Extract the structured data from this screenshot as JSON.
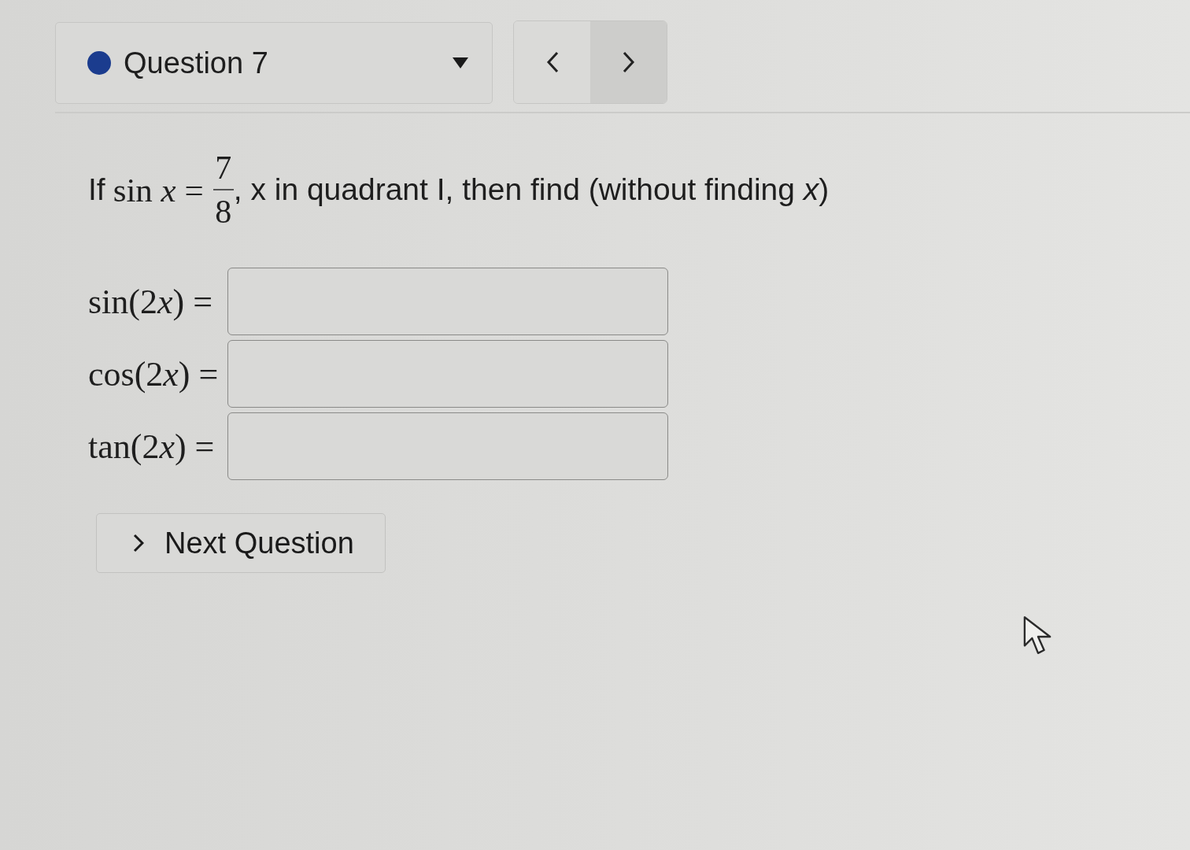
{
  "header": {
    "question_select": {
      "label": "Question 7"
    },
    "nav_buttons": [
      {
        "kind": "previous",
        "highlighted": false
      },
      {
        "kind": "next",
        "highlighted": true
      }
    ]
  },
  "question": {
    "prefix": "If",
    "math": "sin *x* =",
    "numerator": "7",
    "denominator": "8",
    "suffix": ", x in quadrant I, then find (without finding *x*)"
  },
  "answers": [
    {
      "before": "sin(2",
      "var": "x",
      "after": ") ="
    },
    {
      "before": "cos(2",
      "var": "x",
      "after": ") ="
    },
    {
      "before": "tan(2",
      "var": "x",
      "after": ") ="
    }
  ],
  "next_button": {
    "label": "Next Question"
  }
}
